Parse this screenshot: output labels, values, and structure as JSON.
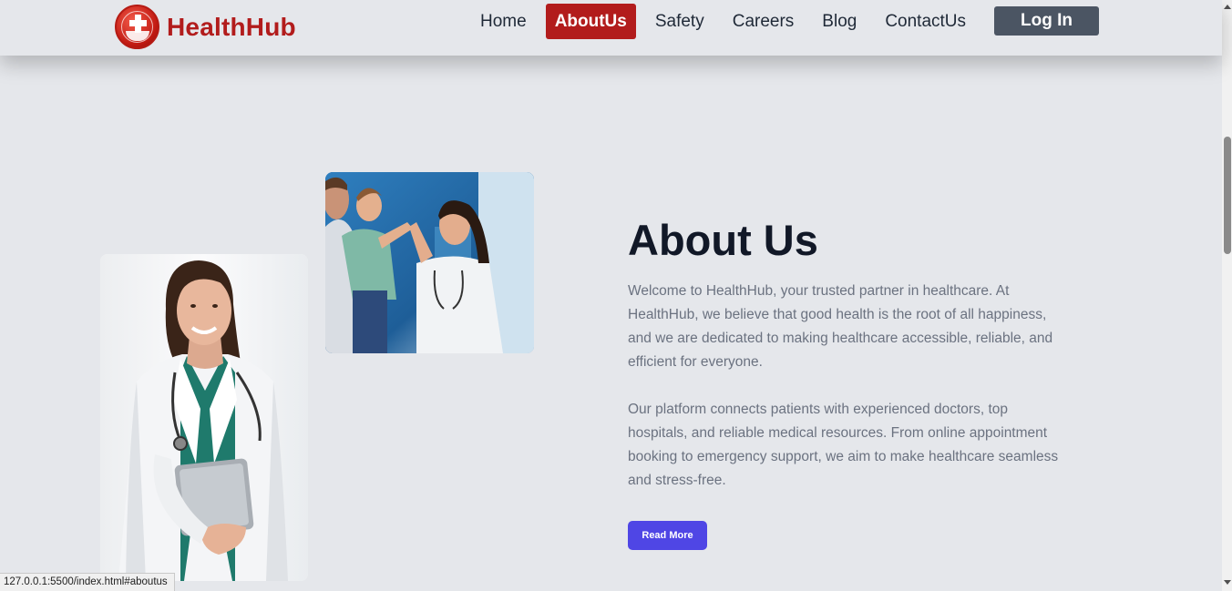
{
  "brand": {
    "name": "HealthHub",
    "color": "#b21c1c",
    "logo_icon": "medical-cross-globe-icon"
  },
  "nav": {
    "items": [
      {
        "label": "Home",
        "active": false
      },
      {
        "label": "AboutUs",
        "active": true
      },
      {
        "label": "Safety",
        "active": false
      },
      {
        "label": "Careers",
        "active": false
      },
      {
        "label": "Blog",
        "active": false
      },
      {
        "label": "ContactUs",
        "active": false
      }
    ],
    "login_label": "Log In"
  },
  "about": {
    "title": "About Us",
    "paragraph1": "Welcome to HealthHub, your trusted partner in healthcare. At HealthHub, we believe that good health is the root of all happiness, and we are dedicated to making healthcare accessible, reliable, and efficient for everyone.",
    "paragraph2": "Our platform connects patients with experienced doctors, top hospitals, and reliable medical resources. From online appointment booking to emergency support, we aim to make healthcare seamless and stress-free.",
    "read_more_label": "Read More",
    "images": [
      "female-doctor-photo",
      "family-high-five-photo"
    ]
  },
  "status_bar": {
    "url": "127.0.0.1:5500/index.html#aboutus"
  },
  "colors": {
    "accent": "#b21c1c",
    "button": "#4f46e5",
    "login": "#4b5563",
    "background": "#e5e7eb"
  }
}
